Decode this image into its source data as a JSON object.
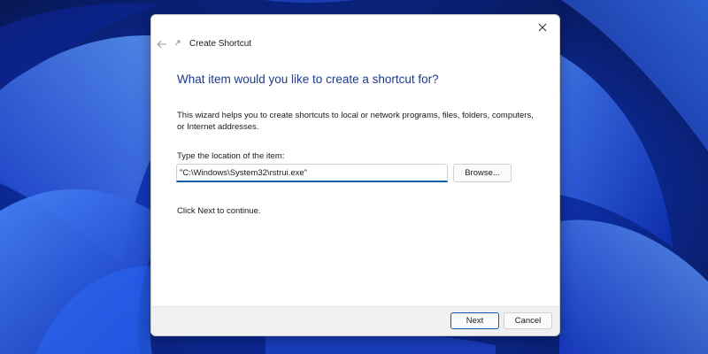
{
  "window": {
    "title": "Create Shortcut",
    "close_symbol": "✕",
    "back_symbol": "←"
  },
  "wizard": {
    "heading": "What item would you like to create a shortcut for?",
    "description": "This wizard helps you to create shortcuts to local or network programs, files, folders, computers, or Internet addresses.",
    "location_label": "Type the location of the item:",
    "location_value": "\"C:\\Windows\\System32\\rstrui.exe\"",
    "browse_label": "Browse...",
    "hint": "Click Next to continue."
  },
  "footer": {
    "next_label": "Next",
    "cancel_label": "Cancel"
  },
  "colors": {
    "heading": "#1e3a8a",
    "accent": "#0b5cad",
    "wallpaper": "#0a1f6e"
  },
  "icons": {
    "close": "close-icon",
    "back": "back-arrow-icon",
    "wizard": "shortcut-wizard-icon",
    "wallpaper": "windows-bloom-wallpaper"
  }
}
